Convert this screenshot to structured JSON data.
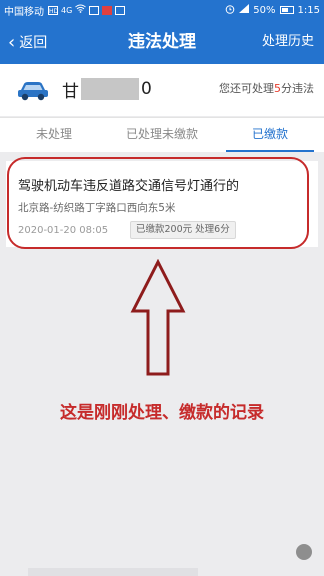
{
  "status_bar": {
    "carrier": "中国移动",
    "hd": "HD",
    "signal": "4G",
    "battery_pct": "50%",
    "time": "1:15"
  },
  "nav": {
    "back_label": "返回",
    "title": "违法处理",
    "right_label": "处理历史"
  },
  "vehicle": {
    "plate_prefix": "甘",
    "plate_suffix": "0",
    "quota_prefix": "您还可处理",
    "quota_num": "5",
    "quota_suffix": "分违法"
  },
  "tabs": [
    {
      "label": "未处理",
      "active": false
    },
    {
      "label": "已处理未缴款",
      "active": false
    },
    {
      "label": "已缴款",
      "active": true
    }
  ],
  "record": {
    "title": "驾驶机动车违反道路交通信号灯通行的",
    "location": "北京路-纺织路丁字路口西向东5米",
    "time": "2020-01-20 08:05",
    "badge": "已缴款200元 处理6分"
  },
  "annotation": {
    "caption": "这是刚刚处理、缴款的记录"
  },
  "colors": {
    "brand": "#2473ce",
    "highlight_red": "#c62b2b",
    "quota_red": "#e53b2c"
  }
}
